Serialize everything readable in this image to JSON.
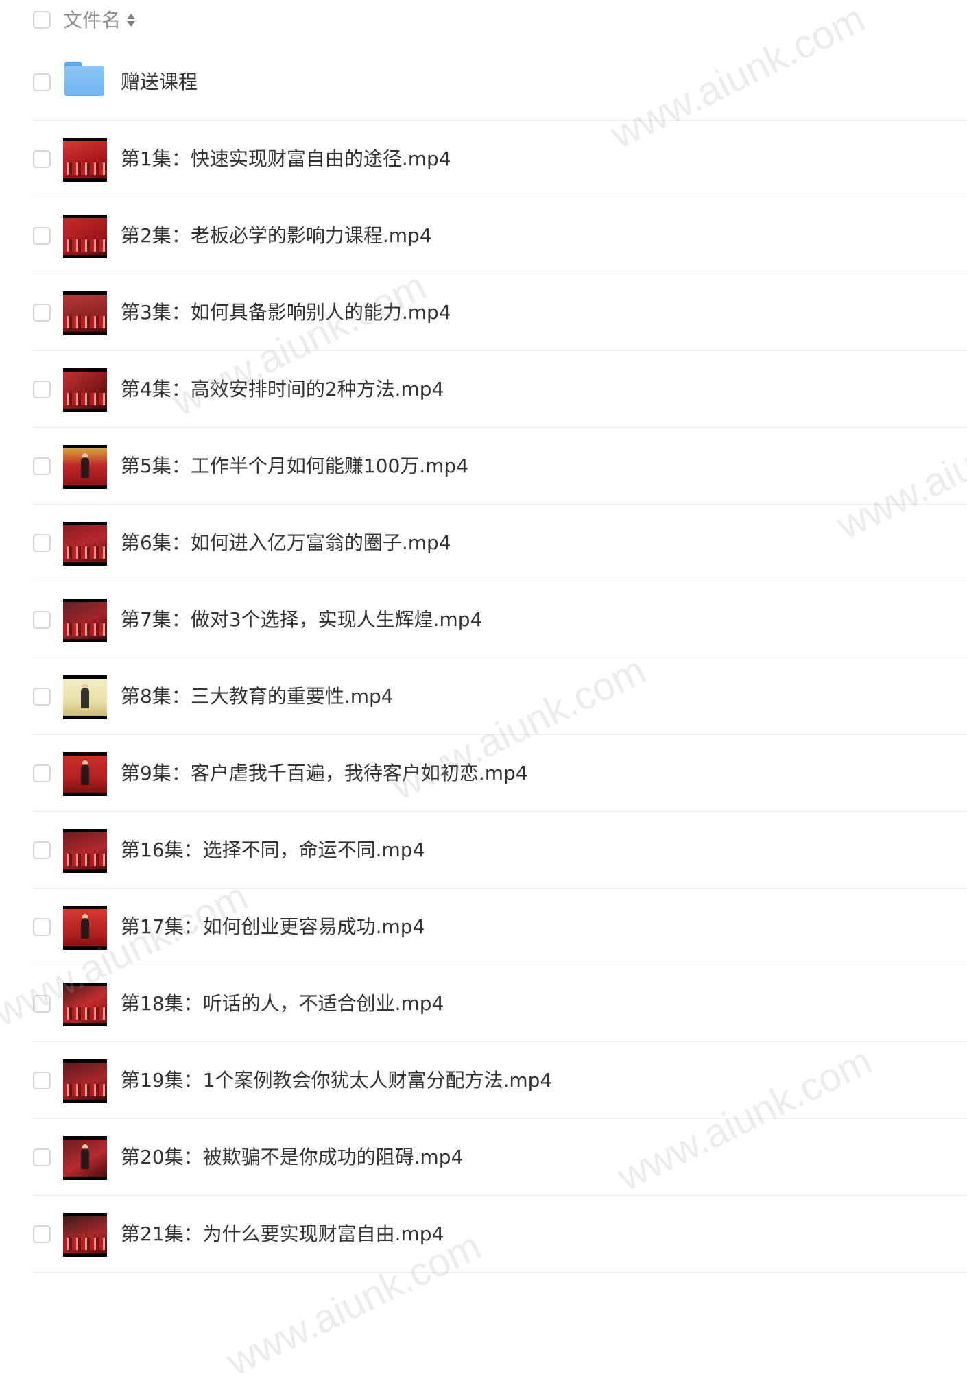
{
  "header": {
    "column_label": "文件名",
    "sort_icon": "sort-updown-icon"
  },
  "files": [
    {
      "name": "赠送课程",
      "type": "folder",
      "icon": "folder-icon"
    },
    {
      "name": "第1集：快速实现财富自由的途径.mp4",
      "type": "video",
      "icon": "video-thumbnail"
    },
    {
      "name": "第2集：老板必学的影响力课程.mp4",
      "type": "video",
      "icon": "video-thumbnail"
    },
    {
      "name": "第3集：如何具备影响别人的能力.mp4",
      "type": "video",
      "icon": "video-thumbnail"
    },
    {
      "name": "第4集：高效安排时间的2种方法.mp4",
      "type": "video",
      "icon": "video-thumbnail"
    },
    {
      "name": "第5集：工作半个月如何能赚100万.mp4",
      "type": "video",
      "icon": "video-thumbnail"
    },
    {
      "name": "第6集：如何进入亿万富翁的圈子.mp4",
      "type": "video",
      "icon": "video-thumbnail"
    },
    {
      "name": "第7集：做对3个选择，实现人生辉煌.mp4",
      "type": "video",
      "icon": "video-thumbnail"
    },
    {
      "name": "第8集：三大教育的重要性.mp4",
      "type": "video",
      "icon": "video-thumbnail"
    },
    {
      "name": "第9集：客户虐我千百遍，我待客户如初恋.mp4",
      "type": "video",
      "icon": "video-thumbnail"
    },
    {
      "name": "第16集：选择不同，命运不同.mp4",
      "type": "video",
      "icon": "video-thumbnail"
    },
    {
      "name": "第17集：如何创业更容易成功.mp4",
      "type": "video",
      "icon": "video-thumbnail"
    },
    {
      "name": "第18集：听话的人，不适合创业.mp4",
      "type": "video",
      "icon": "video-thumbnail"
    },
    {
      "name": "第19集：1个案例教会你犹太人财富分配方法.mp4",
      "type": "video",
      "icon": "video-thumbnail"
    },
    {
      "name": "第20集：被欺骗不是你成功的阻碍.mp4",
      "type": "video",
      "icon": "video-thumbnail"
    },
    {
      "name": "第21集：为什么要实现财富自由.mp4",
      "type": "video",
      "icon": "video-thumbnail"
    }
  ],
  "watermark": {
    "text": "www.aiunk.com"
  },
  "colors": {
    "folder": "#6fb3f1",
    "thumbnail_red": "#b81c24",
    "divider": "#ebedf0",
    "text": "#333333",
    "header_text": "#8a8e94"
  }
}
